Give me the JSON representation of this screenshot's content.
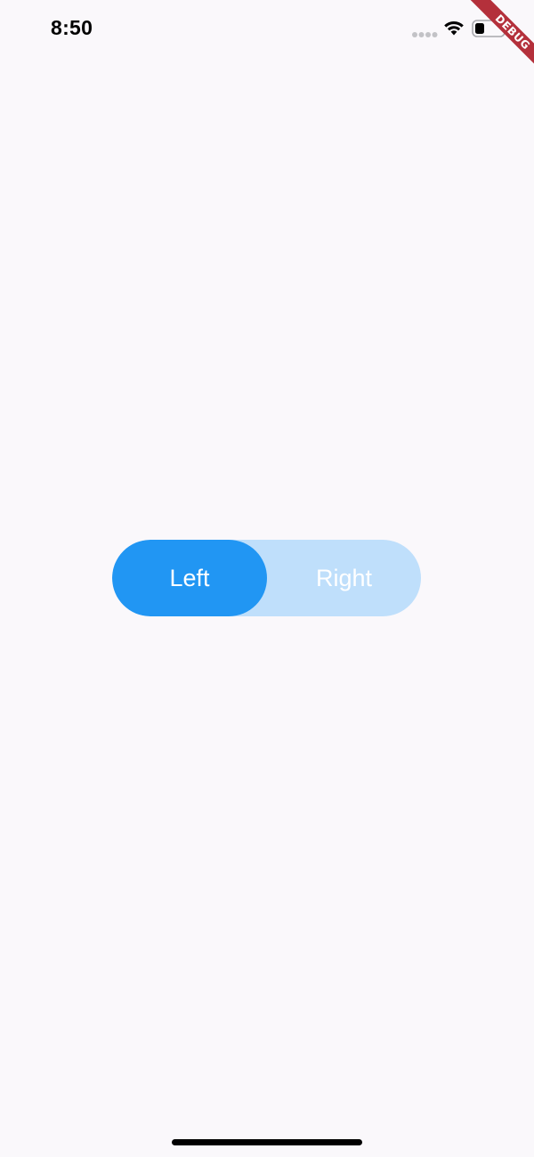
{
  "status_bar": {
    "time": "8:50",
    "icons": [
      "signal-dots-icon",
      "wifi-icon",
      "battery-icon"
    ]
  },
  "debug_banner": {
    "label": "DEBUG"
  },
  "toggle": {
    "left_label": "Left",
    "right_label": "Right",
    "selected": "Left",
    "colors": {
      "selected": "#2196f3",
      "track": "#bfdffb",
      "text": "#ffffff"
    }
  },
  "colors": {
    "background": "#faf8fb",
    "debug_ribbon": "#b4303b"
  }
}
